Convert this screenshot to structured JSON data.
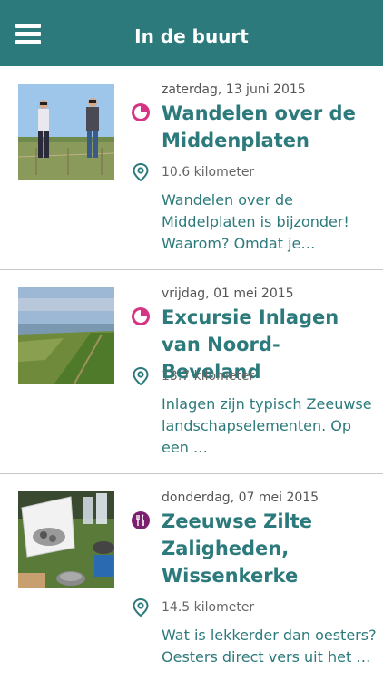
{
  "header": {
    "title": "In de buurt"
  },
  "colors": {
    "header_bg": "#2c7a7b",
    "accent": "#2c7a7b",
    "walk_category": "#d63384",
    "food_category": "#7b1f6e"
  },
  "items": [
    {
      "date": "zaterdag, 13 juni 2015",
      "title": "Wandelen over de Middenplaten",
      "category_icon": "walking-category-icon",
      "distance": "10.6 kilometer",
      "description": "Wandelen over de Middelplaten is bijzonder! Waarom? Omdat je…",
      "thumbnail": "two-men-with-binoculars-photo"
    },
    {
      "date": "vrijdag, 01 mei 2015",
      "title": "Excursie Inlagen van Noord-Beveland",
      "category_icon": "walking-category-icon",
      "distance": "13.7 kilometer",
      "description": "Inlagen zijn typisch Zeeuwse landschapselementen. Op een …",
      "thumbnail": "dike-landscape-photo"
    },
    {
      "date": "donderdag, 07 mei 2015",
      "title": "Zeeuwse Zilte Zaligheden, Wissenkerke",
      "category_icon": "food-category-icon",
      "distance": "14.5 kilometer",
      "description": "Wat is lekkerder dan oesters? Oesters direct vers uit het …",
      "thumbnail": "oysters-cooking-photo"
    }
  ]
}
